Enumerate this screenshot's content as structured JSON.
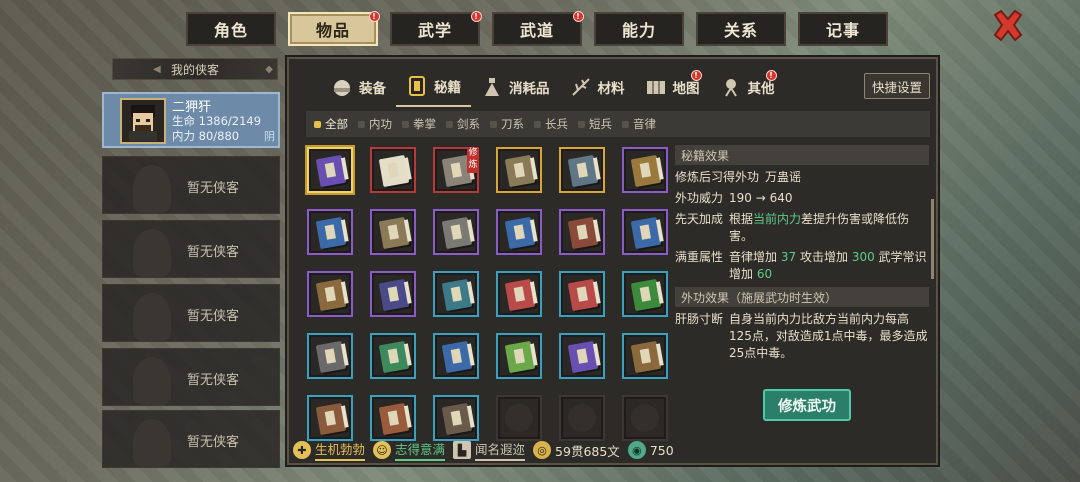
{
  "top_tabs": [
    {
      "label": "角色",
      "active": false,
      "badge": false
    },
    {
      "label": "物品",
      "active": true,
      "badge": true
    },
    {
      "label": "武学",
      "active": false,
      "badge": true
    },
    {
      "label": "武道",
      "active": false,
      "badge": true
    },
    {
      "label": "能力",
      "active": false,
      "badge": false
    },
    {
      "label": "关系",
      "active": false,
      "badge": false
    },
    {
      "label": "记事",
      "active": false,
      "badge": false
    }
  ],
  "badge_mark": "!",
  "left": {
    "header": "我的侠客",
    "hero": {
      "name": "二狎犴",
      "hp_label": "生命",
      "hp": "1386/2149",
      "mp_label": "内力",
      "mp": "80/880",
      "attr": "阴"
    },
    "empty_label": "暂无侠客"
  },
  "category_tabs": [
    {
      "label": "装备",
      "icon": "helmet-icon",
      "badge": false,
      "active": false
    },
    {
      "label": "秘籍",
      "icon": "book-icon",
      "badge": false,
      "active": true
    },
    {
      "label": "消耗品",
      "icon": "potion-icon",
      "badge": false,
      "active": false
    },
    {
      "label": "材料",
      "icon": "herb-icon",
      "badge": false,
      "active": false
    },
    {
      "label": "地图",
      "icon": "map-icon",
      "badge": true,
      "active": false
    },
    {
      "label": "其他",
      "icon": "lantern-icon",
      "badge": true,
      "active": false
    }
  ],
  "quick_button": "快捷设置",
  "filters": [
    {
      "label": "全部",
      "active": true
    },
    {
      "label": "内功",
      "active": false
    },
    {
      "label": "拳掌",
      "active": false
    },
    {
      "label": "剑系",
      "active": false
    },
    {
      "label": "刀系",
      "active": false
    },
    {
      "label": "长兵",
      "active": false
    },
    {
      "label": "短兵",
      "active": false
    },
    {
      "label": "音律",
      "active": false
    }
  ],
  "items": [
    {
      "frame": "purple",
      "color": "#6a4fb2",
      "selected": true
    },
    {
      "frame": "red",
      "color": "#e4ddc8",
      "open": true
    },
    {
      "frame": "red",
      "color": "#8a8378",
      "tag": "修炼"
    },
    {
      "frame": "gold",
      "color": "#8a7a58"
    },
    {
      "frame": "gold",
      "color": "#5f7686"
    },
    {
      "frame": "purple",
      "color": "#9a7a3c"
    },
    {
      "frame": "purple",
      "color": "#3c6aa8"
    },
    {
      "frame": "purple",
      "color": "#8a7a58"
    },
    {
      "frame": "purple",
      "color": "#7a7a72"
    },
    {
      "frame": "purple",
      "color": "#3c6aa8"
    },
    {
      "frame": "purple",
      "color": "#8a4a3a"
    },
    {
      "frame": "purple",
      "color": "#3c6aa8"
    },
    {
      "frame": "purple",
      "color": "#8a6a3c"
    },
    {
      "frame": "purple",
      "color": "#4a4a8a"
    },
    {
      "frame": "blue",
      "color": "#3c7a8a"
    },
    {
      "frame": "blue",
      "color": "#b84a4a"
    },
    {
      "frame": "blue",
      "color": "#b84a4a"
    },
    {
      "frame": "blue",
      "color": "#3c8a3c"
    },
    {
      "frame": "blue",
      "color": "#6a6a6a"
    },
    {
      "frame": "blue",
      "color": "#3c8a5c"
    },
    {
      "frame": "blue",
      "color": "#3c6aa8"
    },
    {
      "frame": "blue",
      "color": "#6aa84a"
    },
    {
      "frame": "blue",
      "color": "#6a4fb2"
    },
    {
      "frame": "blue",
      "color": "#8a6a3c"
    },
    {
      "frame": "blue",
      "color": "#8a5a3c"
    },
    {
      "frame": "blue",
      "color": "#9a5a3c"
    },
    {
      "frame": "blue",
      "color": "#6a5a4a"
    },
    {
      "frame": "empty"
    },
    {
      "frame": "empty"
    },
    {
      "frame": "empty"
    }
  ],
  "detail": {
    "section1": "秘籍效果",
    "learn_label": "修炼后习得外功",
    "learn_value": "万蛊谣",
    "power_label": "外功威力",
    "power_from": "190",
    "power_arrow": "→",
    "power_to": "640",
    "innate_label": "先天加成",
    "innate_pre": "根据",
    "innate_hl": "当前内力",
    "innate_post": "差提升伤害或降低伤害。",
    "full_label": "满重属性",
    "full_a": "音律增加",
    "full_a_val": "37",
    "full_b": "攻击增加",
    "full_b_val": "300",
    "full_c": "武学常识增加",
    "full_c_val": "60",
    "section2": "外功效果（施展武功时生效）",
    "effect_label": "肝肠寸断",
    "effect_text": "自身当前内力比敌方当前内力每高125点，对敌造成1点中毒，最多造成25点中毒。"
  },
  "train_button": "修炼武功",
  "status": [
    {
      "label": "生机勃勃",
      "color": "#e3c156",
      "icon": "vitality-icon"
    },
    {
      "label": "志得意满",
      "color": "#5fc98a",
      "icon": "mood-icon"
    },
    {
      "label": "闻名遐迩",
      "color": "#cfc6b2",
      "icon": "fame-icon"
    },
    {
      "label": "59贯685文",
      "color": "#e8dfc9",
      "icon": "coin-icon"
    },
    {
      "label": "750",
      "color": "#e8dfc9",
      "icon": "jade-icon"
    }
  ]
}
